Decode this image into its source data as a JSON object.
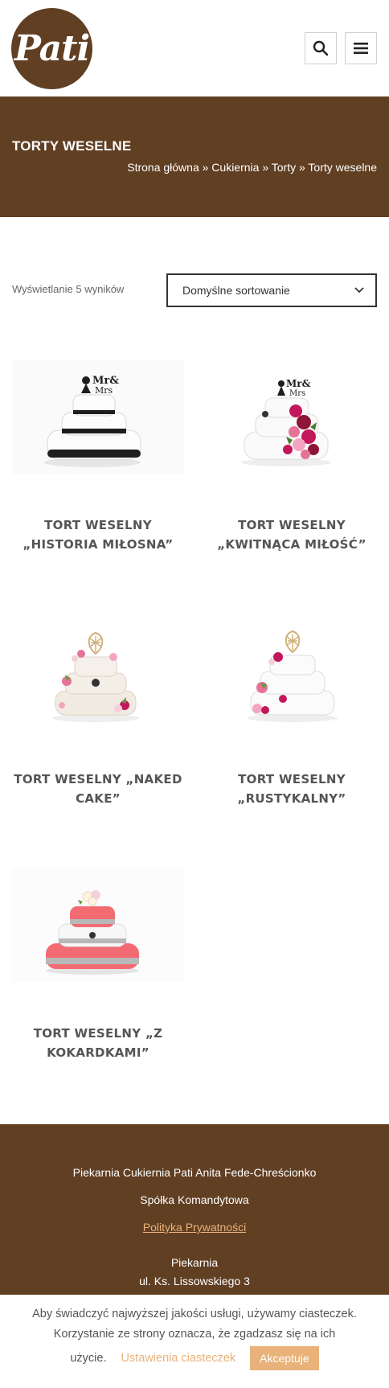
{
  "header": {
    "logo_text": "Pati",
    "search_icon": "search-icon",
    "menu_icon": "hamburger-menu-icon"
  },
  "banner": {
    "title": "TORTY WESELNE",
    "breadcrumb": "Strona główna » Cukiernia » Torty » Torty weselne"
  },
  "toolbar": {
    "result_count": "Wyświetlanie 5 wyników",
    "sort_selected": "Domyślne sortowanie"
  },
  "products": [
    {
      "title_line1": "TORT WESELNY",
      "title_line2": "„HISTORIA MIŁOSNA”"
    },
    {
      "title_line1": "TORT WESELNY",
      "title_line2": "„KWITNĄCA MIŁOŚĆ”"
    },
    {
      "title_line1": "TORT WESELNY „NAKED",
      "title_line2": "CAKE”"
    },
    {
      "title_line1": "TORT WESELNY",
      "title_line2": "„RUSTYKALNY”"
    },
    {
      "title_line1": "TORT WESELNY „Z",
      "title_line2": "KOKARDKAMI”"
    }
  ],
  "footer": {
    "company_line1": "Piekarnia Cukiernia Pati Anita Fede-Chreścionko",
    "company_line2": "Spółka Komandytowa",
    "privacy_link": "Polityka Prywatności",
    "section": "Piekarnia",
    "address": "ul. Ks. Lissowskiego 3"
  },
  "cookie": {
    "line1": "Aby świadczyć najwyższej jakości usługi, używamy ciasteczek.",
    "line2": "Korzystanie ze strony oznacza, że zgadzasz się na ich",
    "line3": "użycie.",
    "settings": "Ustawienia ciasteczek",
    "accept": "Akceptuje"
  },
  "colors": {
    "brand_brown": "#613f23",
    "accent_orange": "#e8b27a"
  }
}
